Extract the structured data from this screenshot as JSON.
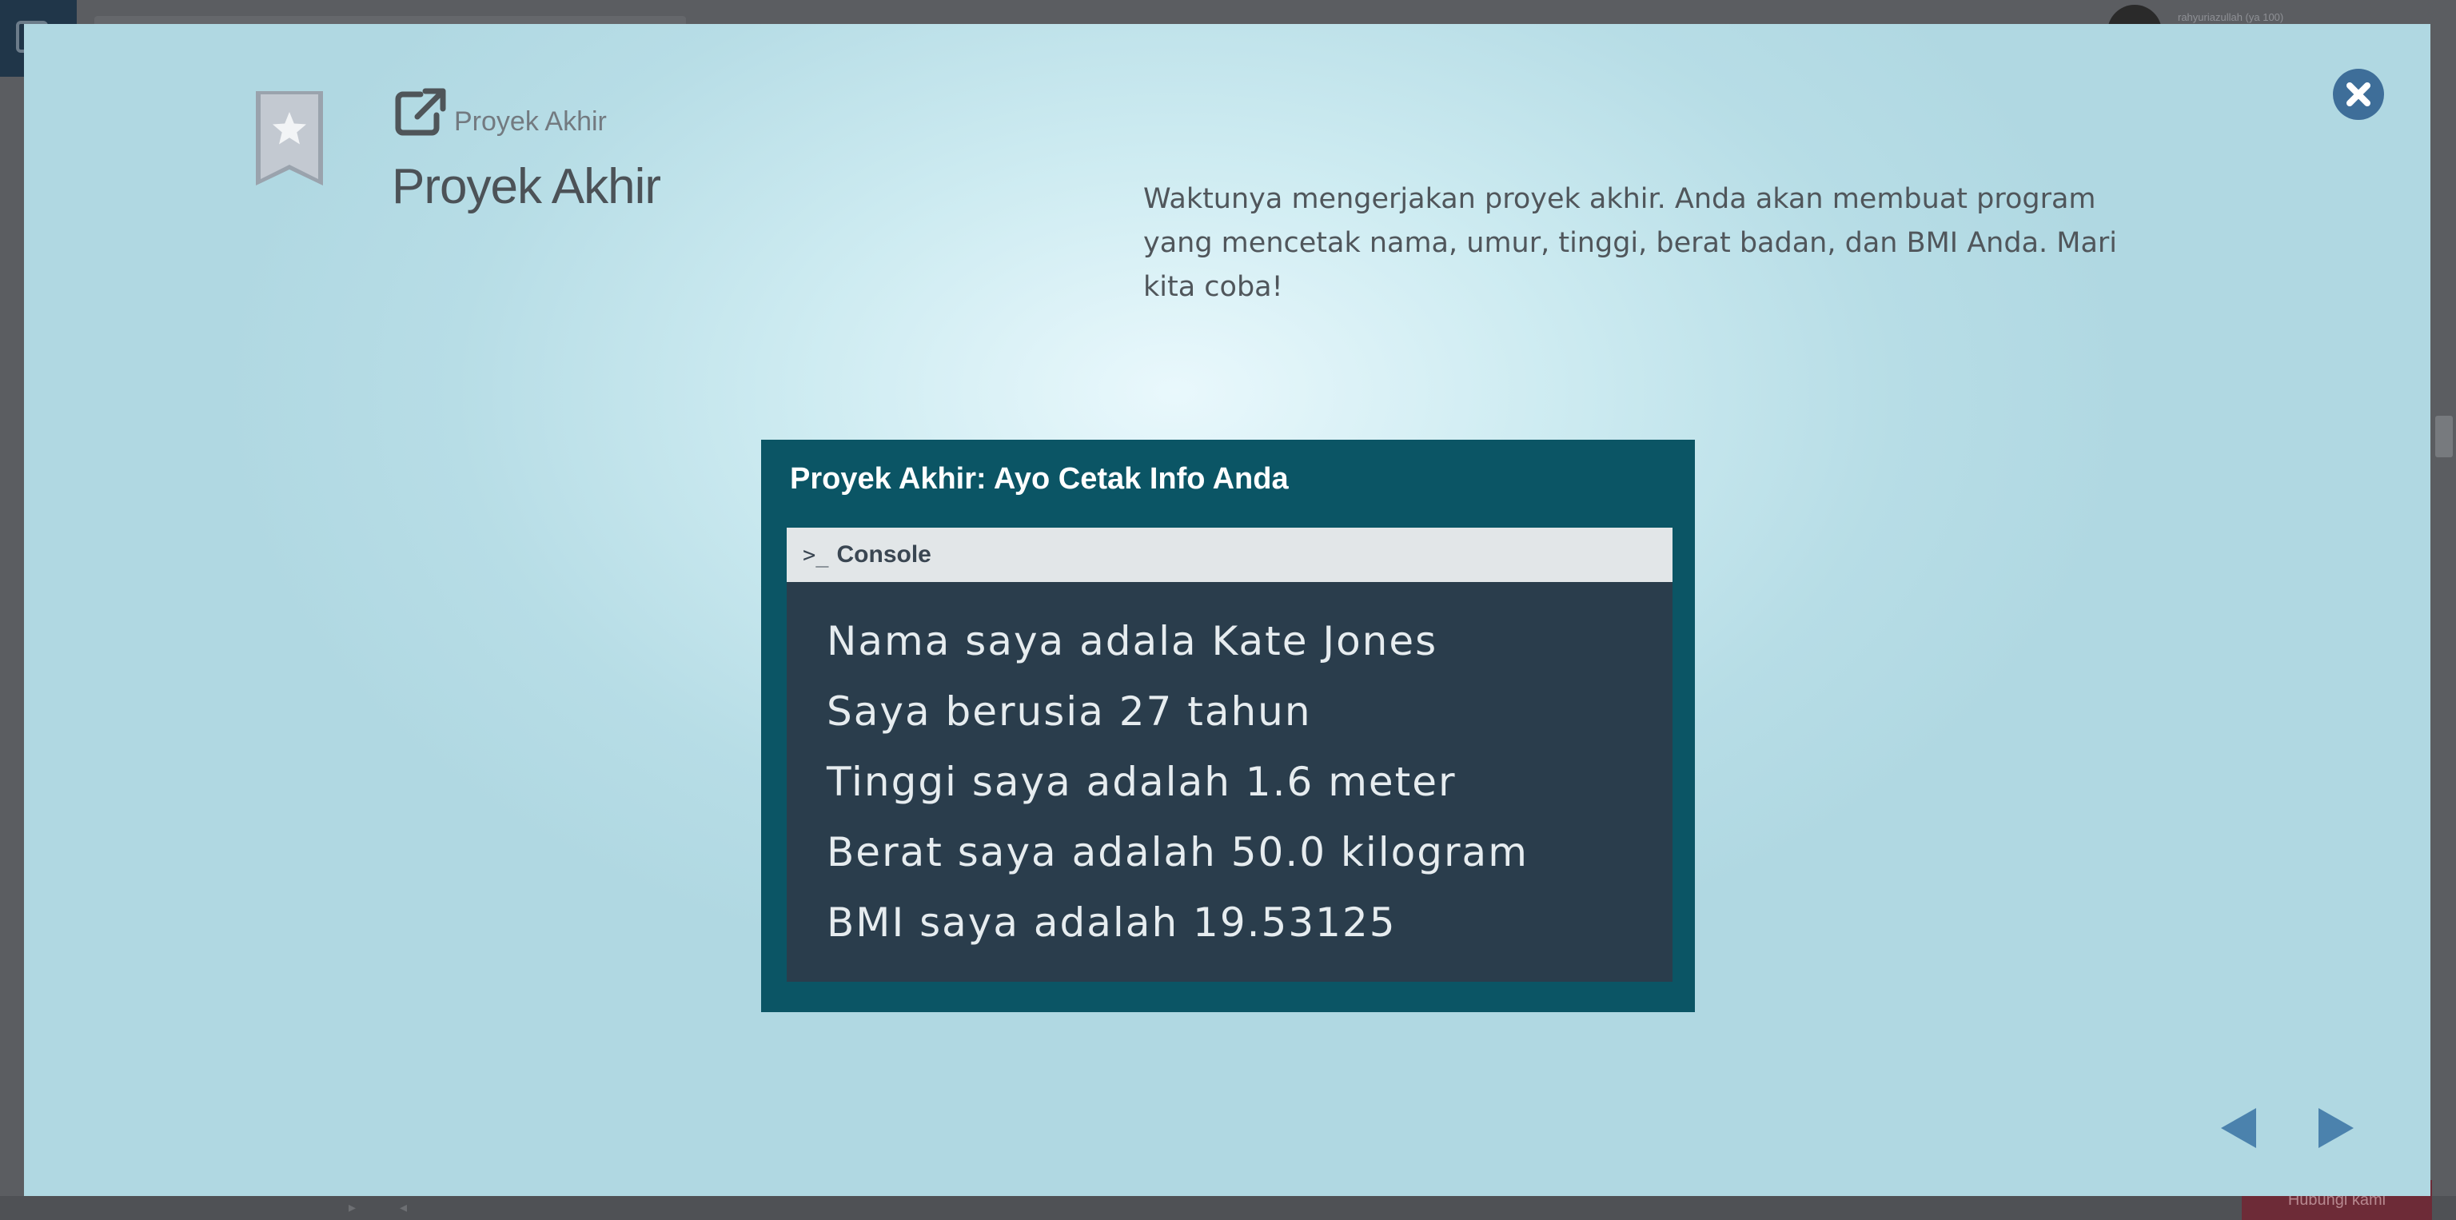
{
  "background": {
    "username": "rahyuriazullah (ya 100)",
    "help_button": "Hubungi kami"
  },
  "modal": {
    "breadcrumb": "Proyek Akhir",
    "title": "Proyek Akhir",
    "description": "Waktunya mengerjakan proyek akhir. Anda akan membuat program yang mencetak nama, umur, tinggi, berat badan, dan BMI Anda. Mari kita coba!",
    "icons": {
      "bookmark": "bookmark-star-icon",
      "breadcrumb": "external-link-icon",
      "close": "close-icon",
      "prev": "arrow-left-icon",
      "next": "arrow-right-icon"
    },
    "lesson_image": {
      "title": "Proyek Akhir: Ayo Cetak Info Anda",
      "console_icon": ">_",
      "console_label": "Console",
      "lines": [
        "Nama saya adala Kate Jones",
        "Saya berusia 27 tahun",
        "Tinggi saya adalah 1.6 meter",
        "Berat saya adalah 50.0 kilogram",
        "BMI saya adalah 19.53125"
      ]
    }
  },
  "colors": {
    "accent": "#3e6e99",
    "lesson_bg": "#0b5565",
    "console_bg": "#2a3d4c",
    "modal_bg": "#cdebf1"
  }
}
